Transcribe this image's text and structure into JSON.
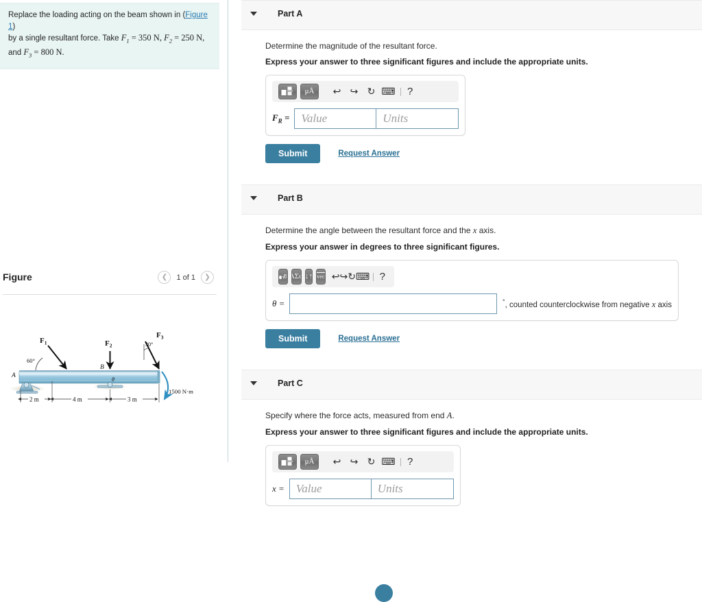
{
  "problem": {
    "line1_a": "Replace the loading acting on the beam shown in (",
    "figure_link": "Figure 1",
    "line1_b": ")",
    "line2_a": "by a single resultant force. Take ",
    "f1_sym": "F",
    "f1_sub": "1",
    "f1_val": " = 350 N",
    "comma1": ", ",
    "f2_sym": "F",
    "f2_sub": "2",
    "f2_val": " = 250 N",
    "comma2": ",",
    "line3_a": "and ",
    "f3_sym": "F",
    "f3_sub": "3",
    "f3_val": " = 800 N",
    "period": "."
  },
  "figure": {
    "title": "Figure",
    "prev_icon": "chevron-left-icon",
    "next_icon": "chevron-right-icon",
    "counter": "1 of 1",
    "diagram": {
      "label_A": "A",
      "label_B": "B",
      "force1": "F",
      "force1_sub": "1",
      "force2": "F",
      "force2_sub": "2",
      "force3": "F",
      "force3_sub": "3",
      "angle1": "60°",
      "angle3": "30°",
      "theta": "θ",
      "moment": "1500 N·m",
      "dim1": "2 m",
      "dim2": "4 m",
      "dim3": "3 m"
    }
  },
  "parts": [
    {
      "id": "a",
      "label": "Part A",
      "caret_icon": "caret-down-icon",
      "prompt": "Determine the magnitude of the resultant force.",
      "instruction": "Express your answer to three significant figures and include the appropriate units.",
      "toolbar": {
        "buttons": [
          {
            "name": "math-template-button",
            "label": ""
          },
          {
            "name": "units-button",
            "label": "μÅ"
          }
        ],
        "undo_icon": "undo-icon",
        "redo_icon": "redo-icon",
        "reset_icon": "reset-icon",
        "keyboard_icon": "keyboard-icon",
        "help_icon": "help-icon",
        "help_label": "?"
      },
      "field_label": "F",
      "field_label_sub": "R",
      "field_label_eq": " =",
      "value_placeholder": "Value",
      "units_placeholder": "Units",
      "suffix": "",
      "submit_label": "Submit",
      "request_label": "Request Answer"
    },
    {
      "id": "b",
      "label": "Part B",
      "caret_icon": "caret-down-icon",
      "prompt_a": "Determine the angle between the resultant force and the ",
      "prompt_var": "x",
      "prompt_b": " axis.",
      "instruction": "Express your answer in degrees to three significant figures.",
      "toolbar": {
        "buttons": [
          {
            "name": "math-template-button",
            "label": ""
          },
          {
            "name": "greek-symbols-button",
            "label": "ΑΣφ"
          },
          {
            "name": "sub-sup-button",
            "label": "↓↑"
          },
          {
            "name": "vector-button",
            "label": "vec"
          }
        ],
        "undo_icon": "undo-icon",
        "redo_icon": "redo-icon",
        "reset_icon": "reset-icon",
        "keyboard_icon": "keyboard-icon",
        "help_label": "?"
      },
      "field_label": "θ =",
      "suffix_deg": "°",
      "suffix_a": ", counted counterclockwise from negative ",
      "suffix_var": "x",
      "suffix_b": " axis",
      "submit_label": "Submit",
      "request_label": "Request Answer"
    },
    {
      "id": "c",
      "label": "Part C",
      "caret_icon": "caret-down-icon",
      "prompt_a": "Specify where the force acts, measured from end ",
      "prompt_var": "A",
      "prompt_b": ".",
      "instruction": "Express your answer to three significant figures and include the appropriate units.",
      "toolbar": {
        "buttons": [
          {
            "name": "math-template-button",
            "label": ""
          },
          {
            "name": "units-button",
            "label": "μÅ"
          }
        ],
        "undo_icon": "undo-icon",
        "redo_icon": "redo-icon",
        "reset_icon": "reset-icon",
        "keyboard_icon": "keyboard-icon",
        "help_label": "?"
      },
      "field_label": "x =",
      "value_placeholder": "Value",
      "units_placeholder": "Units"
    }
  ],
  "colors": {
    "accent_button": "#3a7fa0",
    "link": "#2a6f93",
    "problem_bg": "#e9f5f3",
    "part_header_bg": "#f7f7f7",
    "field_border": "#6e96ae"
  }
}
